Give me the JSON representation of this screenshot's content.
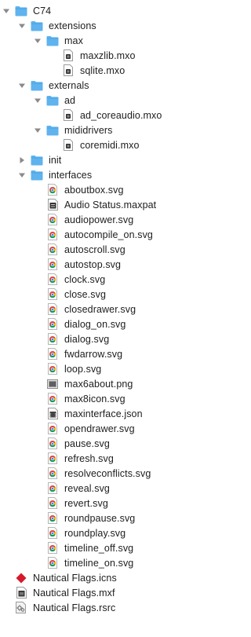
{
  "colors": {
    "folder_body": "#5fb3ee",
    "folder_tab": "#4aa3e3",
    "triangle": "#8a8a8a",
    "red_diamond": "#d7192b"
  },
  "tree": [
    {
      "label": "C74",
      "icon": "folder-icon",
      "depth": 0,
      "expand": "open"
    },
    {
      "label": "extensions",
      "icon": "folder-icon",
      "depth": 1,
      "expand": "open"
    },
    {
      "label": "max",
      "icon": "folder-icon",
      "depth": 2,
      "expand": "open"
    },
    {
      "label": "maxzlib.mxo",
      "icon": "plugin-file-icon",
      "depth": 3,
      "expand": "none"
    },
    {
      "label": "sqlite.mxo",
      "icon": "plugin-file-icon",
      "depth": 3,
      "expand": "none"
    },
    {
      "label": "externals",
      "icon": "folder-icon",
      "depth": 1,
      "expand": "open"
    },
    {
      "label": "ad",
      "icon": "folder-icon",
      "depth": 2,
      "expand": "open"
    },
    {
      "label": "ad_coreaudio.mxo",
      "icon": "plugin-file-icon",
      "depth": 3,
      "expand": "none"
    },
    {
      "label": "mididrivers",
      "icon": "folder-icon",
      "depth": 2,
      "expand": "open"
    },
    {
      "label": "coremidi.mxo",
      "icon": "plugin-file-icon",
      "depth": 3,
      "expand": "none"
    },
    {
      "label": "init",
      "icon": "folder-icon",
      "depth": 1,
      "expand": "closed"
    },
    {
      "label": "interfaces",
      "icon": "folder-icon",
      "depth": 1,
      "expand": "open"
    },
    {
      "label": "aboutbox.svg",
      "icon": "chrome-svg-file-icon",
      "depth": 2,
      "expand": "none"
    },
    {
      "label": "Audio Status.maxpat",
      "icon": "maxpat-file-icon",
      "depth": 2,
      "expand": "none"
    },
    {
      "label": "audiopower.svg",
      "icon": "chrome-svg-file-icon",
      "depth": 2,
      "expand": "none"
    },
    {
      "label": "autocompile_on.svg",
      "icon": "chrome-svg-file-icon",
      "depth": 2,
      "expand": "none"
    },
    {
      "label": "autoscroll.svg",
      "icon": "chrome-svg-file-icon",
      "depth": 2,
      "expand": "none"
    },
    {
      "label": "autostop.svg",
      "icon": "chrome-svg-file-icon",
      "depth": 2,
      "expand": "none"
    },
    {
      "label": "clock.svg",
      "icon": "chrome-svg-file-icon",
      "depth": 2,
      "expand": "none"
    },
    {
      "label": "close.svg",
      "icon": "chrome-svg-file-icon",
      "depth": 2,
      "expand": "none"
    },
    {
      "label": "closedrawer.svg",
      "icon": "chrome-svg-file-icon",
      "depth": 2,
      "expand": "none"
    },
    {
      "label": "dialog_on.svg",
      "icon": "chrome-svg-file-icon",
      "depth": 2,
      "expand": "none"
    },
    {
      "label": "dialog.svg",
      "icon": "chrome-svg-file-icon",
      "depth": 2,
      "expand": "none"
    },
    {
      "label": "fwdarrow.svg",
      "icon": "chrome-svg-file-icon",
      "depth": 2,
      "expand": "none"
    },
    {
      "label": "loop.svg",
      "icon": "chrome-svg-file-icon",
      "depth": 2,
      "expand": "none"
    },
    {
      "label": "max6about.png",
      "icon": "png-image-file-icon",
      "depth": 2,
      "expand": "none"
    },
    {
      "label": "max8icon.svg",
      "icon": "chrome-svg-file-icon",
      "depth": 2,
      "expand": "none"
    },
    {
      "label": "maxinterface.json",
      "icon": "json-file-icon",
      "depth": 2,
      "expand": "none"
    },
    {
      "label": "opendrawer.svg",
      "icon": "chrome-svg-file-icon",
      "depth": 2,
      "expand": "none"
    },
    {
      "label": "pause.svg",
      "icon": "chrome-svg-file-icon",
      "depth": 2,
      "expand": "none"
    },
    {
      "label": "refresh.svg",
      "icon": "chrome-svg-file-icon",
      "depth": 2,
      "expand": "none"
    },
    {
      "label": "resolveconflicts.svg",
      "icon": "chrome-svg-file-icon",
      "depth": 2,
      "expand": "none"
    },
    {
      "label": "reveal.svg",
      "icon": "chrome-svg-file-icon",
      "depth": 2,
      "expand": "none"
    },
    {
      "label": "revert.svg",
      "icon": "chrome-svg-file-icon",
      "depth": 2,
      "expand": "none"
    },
    {
      "label": "roundpause.svg",
      "icon": "chrome-svg-file-icon",
      "depth": 2,
      "expand": "none"
    },
    {
      "label": "roundplay.svg",
      "icon": "chrome-svg-file-icon",
      "depth": 2,
      "expand": "none"
    },
    {
      "label": "timeline_off.svg",
      "icon": "chrome-svg-file-icon",
      "depth": 2,
      "expand": "none"
    },
    {
      "label": "timeline_on.svg",
      "icon": "chrome-svg-file-icon",
      "depth": 2,
      "expand": "none"
    },
    {
      "label": "Nautical Flags.icns",
      "icon": "red-diamond-icns-icon",
      "depth": 0,
      "expand": "none"
    },
    {
      "label": "Nautical Flags.mxf",
      "icon": "mxf-file-icon",
      "depth": 0,
      "expand": "none"
    },
    {
      "label": "Nautical Flags.rsrc",
      "icon": "rsrc-file-icon",
      "depth": 0,
      "expand": "none"
    }
  ]
}
